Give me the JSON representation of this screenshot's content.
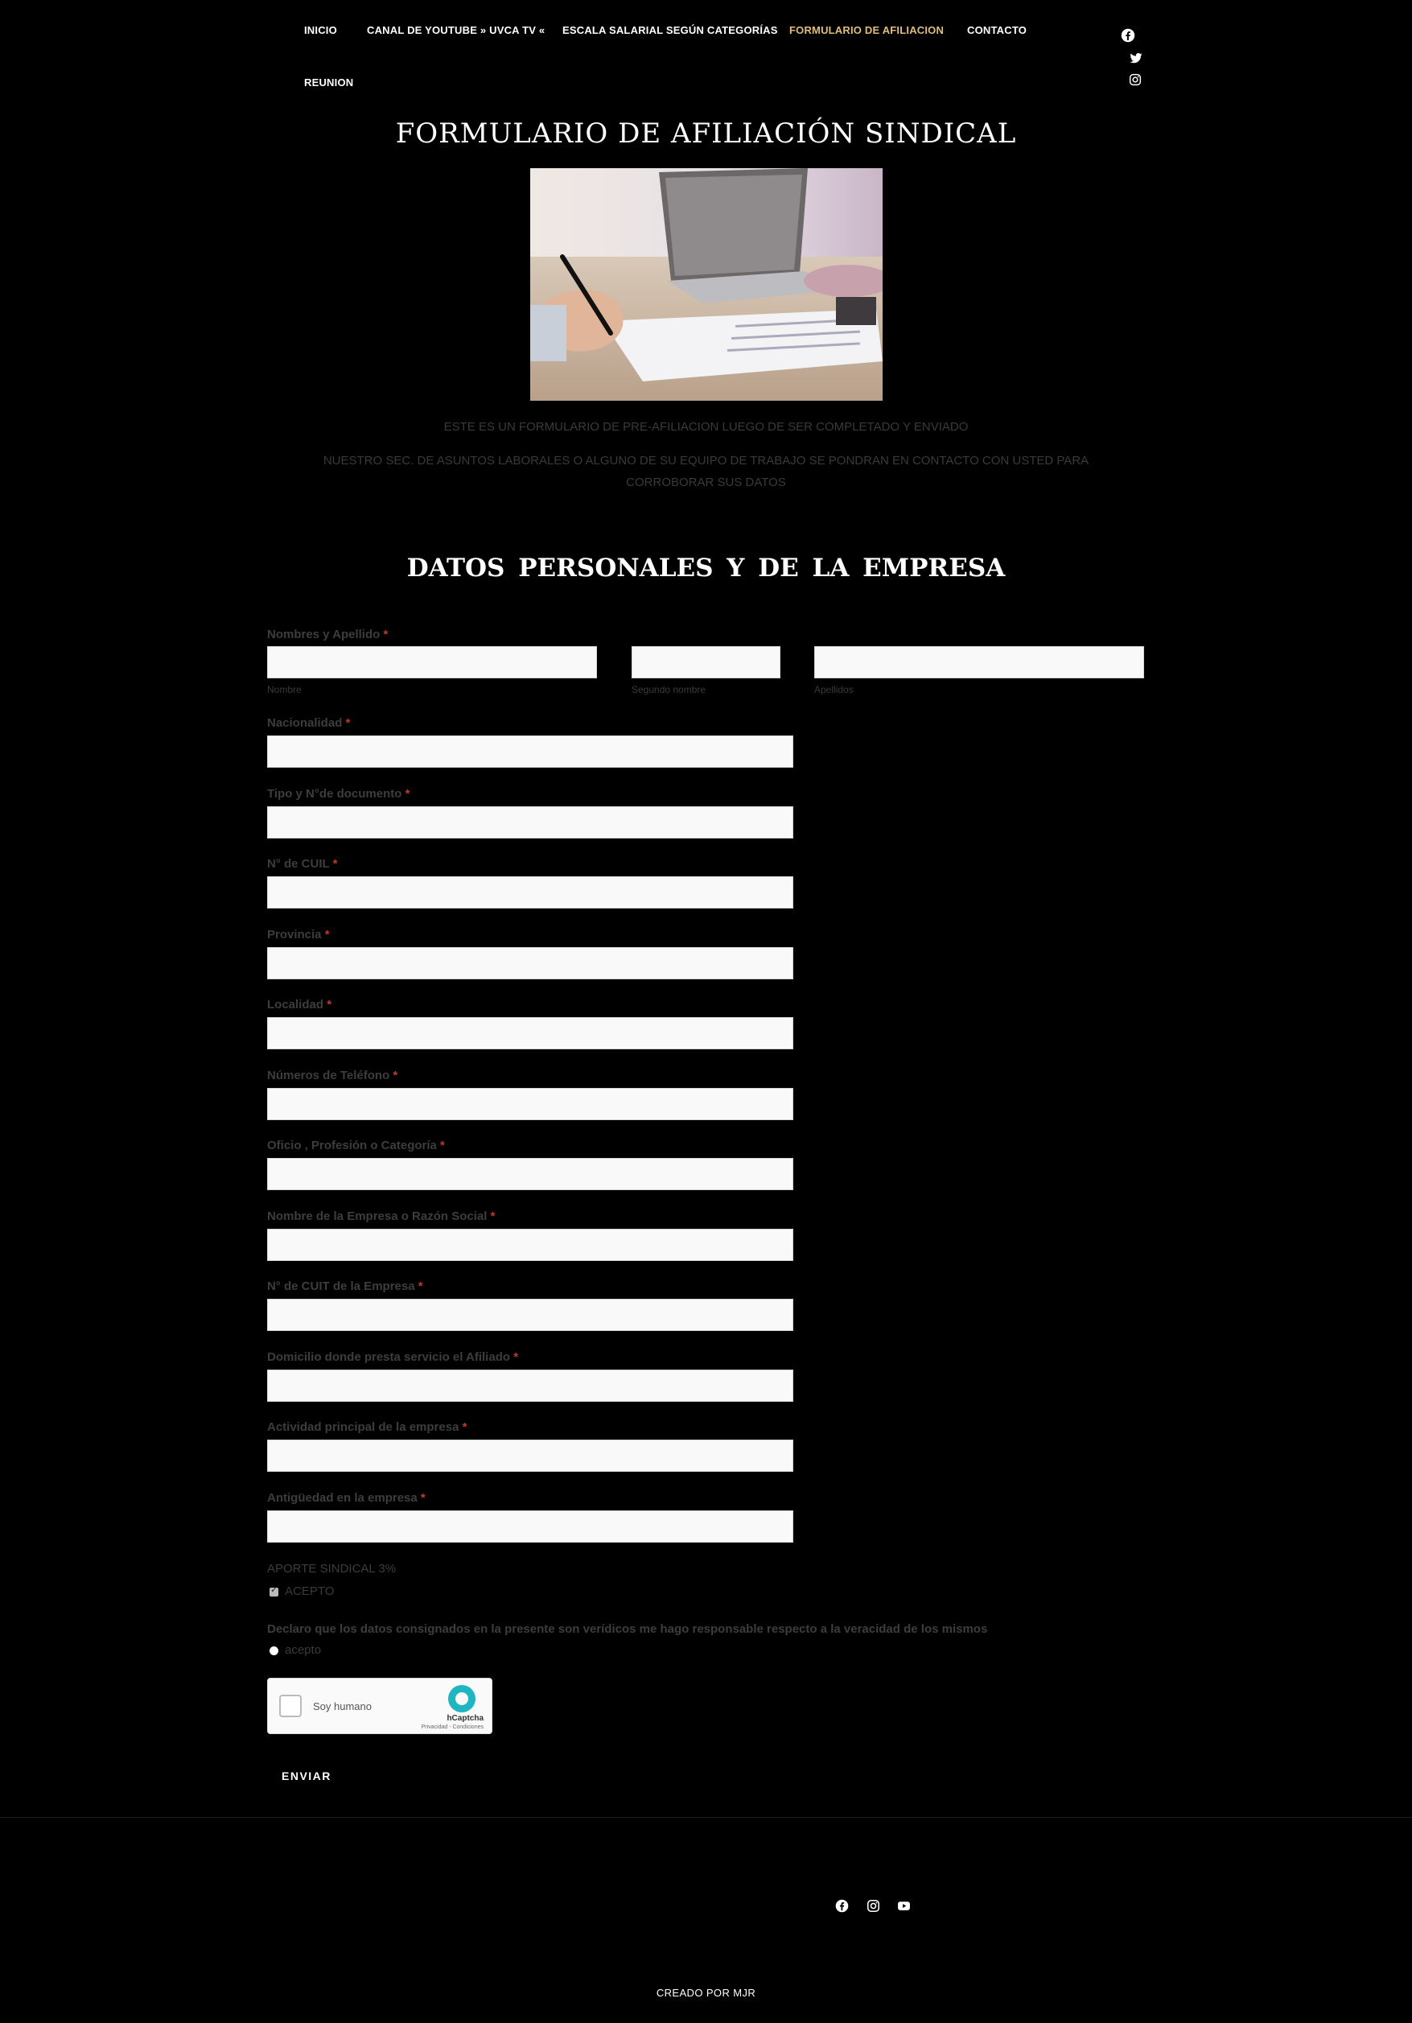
{
  "nav": {
    "items": [
      {
        "label": "INICIO",
        "active": false
      },
      {
        "label": "CANAL DE YOUTUBE » UVCA TV «",
        "active": false
      },
      {
        "label": "ESCALA SALARIAL SEGÚN CATEGORÍAS",
        "active": false
      },
      {
        "label": "FORMULARIO DE AFILIACION",
        "active": true
      },
      {
        "label": "CONTACTO",
        "active": false
      },
      {
        "label": "REUNION",
        "active": false
      }
    ],
    "social_icons": [
      "facebook-icon",
      "twitter-icon",
      "instagram-icon"
    ]
  },
  "page": {
    "title": "FORMULARIO DE AFILIACIÓN SINDICAL",
    "intro_line1": "ESTE ES UN FORMULARIO DE PRE-AFILIACION  LUEGO DE SER COMPLETADO Y ENVIADO",
    "intro_line2": "NUESTRO SEC. DE  ASUNTOS LABORALES O ALGUNO DE SU EQUIPO DE TRABAJO SE PONDRAN EN CONTACTO CON USTED PARA CORROBORAR  SUS DATOS",
    "section_title": "DATOS  PERSONALES  Y   DE  LA  EMPRESA"
  },
  "form": {
    "name_label": "Nombres y Apellido",
    "name_sublabels": [
      "Nombre",
      "Segundo nombre",
      "Apellidos"
    ],
    "fields": [
      {
        "label": "Nacionalidad"
      },
      {
        "label": "Tipo y N°de documento"
      },
      {
        "label": "N° de CUIL"
      },
      {
        "label": "Provincia"
      },
      {
        "label": "Localidad"
      },
      {
        "label": "Números de Teléfono"
      },
      {
        "label": "Oficio , Profesión o Categoría"
      },
      {
        "label": "Nombre de la Empresa o Razón Social"
      },
      {
        "label": "N° de CUIT de la Empresa"
      },
      {
        "label": "Domicilio donde presta servicio el Afiliado"
      },
      {
        "label": "Actividad principal de la empresa"
      },
      {
        "label": "Antigüedad en la empresa"
      }
    ],
    "required_mark": "*",
    "aporte_label": "APORTE SINDICAL 3%",
    "aporte_option": "ACEPTO",
    "aporte_checked": true,
    "declaration_label": "Declaro que los datos consignados en la presente son verídicos me hago responsable respecto a la veracidad de los mismos",
    "declaration_option": "acepto",
    "captcha_label": "Soy humano",
    "captcha_brand": "hCaptcha",
    "captcha_links": "Privacidad - Condiciones",
    "submit_label": "ENVIAR"
  },
  "footer": {
    "social_icons": [
      "facebook-icon",
      "instagram-icon",
      "youtube-icon"
    ],
    "credits": "CREADO POR  MJR"
  },
  "colors": {
    "background": "#000000",
    "accent_active_nav": "#e0bd7c",
    "label_text": "#3d3d3d",
    "required": "#c0392b",
    "input_bg": "#f9f9f9"
  }
}
